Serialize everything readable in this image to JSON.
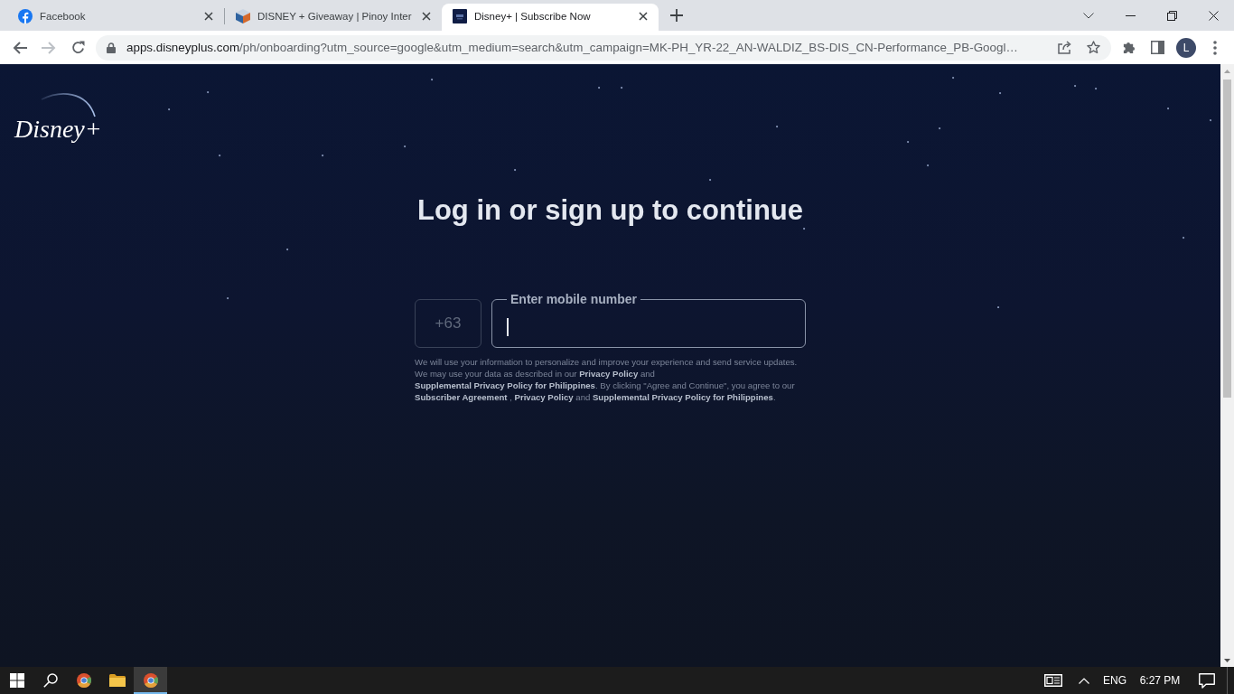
{
  "browser": {
    "tabs": [
      {
        "title": "Facebook",
        "selected": false
      },
      {
        "title": "DISNEY + Giveaway | Pinoy Inter",
        "selected": false
      },
      {
        "title": "Disney+ | Subscribe Now",
        "selected": true
      }
    ],
    "back": {
      "disabled": false
    },
    "forward": {
      "disabled": true
    },
    "address": {
      "host": "apps.disneyplus.com",
      "path": "/ph/onboarding?utm_source=google&utm_medium=search&utm_campaign=MK-PH_YR-22_AN-WALDIZ_BS-DIS_CN-Performance_PB-Googl…"
    },
    "profile_initial": "L"
  },
  "page": {
    "logo": "Disney+",
    "heading": "Log in or sign up to continue",
    "country_code": "+63",
    "mobile_field": {
      "label": "Enter mobile number",
      "focused": true
    },
    "disclaimer": [
      {
        "kind": "text",
        "text": "We will use your information to personalize and improve your experience and send service updates. We may use your data as described in our "
      },
      {
        "kind": "link",
        "text": "Privacy Policy"
      },
      {
        "kind": "text",
        "text": " and "
      },
      {
        "kind": "link",
        "text": "Supplemental Privacy Policy for Philippines"
      },
      {
        "kind": "text",
        "text": ". By clicking \"Agree and Continue\", you agree to our "
      },
      {
        "kind": "link",
        "text": "Subscriber Agreement"
      },
      {
        "kind": "text",
        "text": " , "
      },
      {
        "kind": "link",
        "text": "Privacy Policy"
      },
      {
        "kind": "text",
        "text": " and "
      },
      {
        "kind": "link",
        "text": "Supplemental Privacy Policy for Philippines"
      },
      {
        "kind": "text",
        "text": "."
      }
    ]
  },
  "taskbar": {
    "apps": [
      {
        "active": false
      },
      {
        "active": false
      },
      {
        "active": true
      }
    ],
    "language": "ENG",
    "time": "6:27 PM"
  }
}
